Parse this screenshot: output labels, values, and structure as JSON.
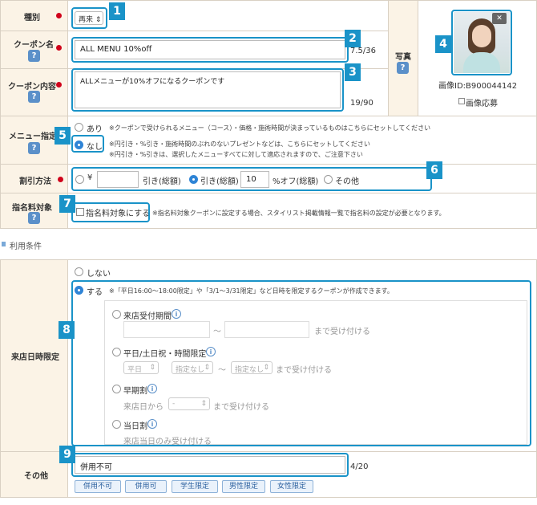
{
  "labels": {
    "type": "種別",
    "coupon_name": "クーポン名",
    "coupon_content": "クーポン内容",
    "menu": "メニュー指定",
    "discount": "割引方法",
    "nomination": "指名料対象",
    "photo": "写真",
    "visit": "来店日時限定",
    "other": "その他"
  },
  "help_icon": "?",
  "badges": [
    "1",
    "2",
    "3",
    "4",
    "5",
    "6",
    "7",
    "8",
    "9"
  ],
  "type_select": {
    "value": "再来"
  },
  "coupon_name": {
    "value": "ALL MENU 10%off",
    "count": "7.5/36"
  },
  "coupon_content": {
    "value": "ALLメニューが10%オフになるクーポンです",
    "count": "19/90"
  },
  "photo": {
    "close": "✕",
    "image_id": "画像ID:B900044142",
    "apply_label": "画像応募"
  },
  "menu": {
    "opt_yes": "あり",
    "opt_yes_note": "※クーポンで受けられるメニュー（コース）・価格・施術時間が決まっているものはこちらにセットしてください",
    "opt_no": "なし",
    "opt_no_note1": "※円引き・%引き・施術時間のぶれのないプレゼントなどは、こちらにセットしてください",
    "opt_no_note2": "※円引き・%引きは、選択したメニューすべてに対して適応されますので、ご注意下さい"
  },
  "discount": {
    "yen": "¥",
    "yen_suffix": "引き(総額)",
    "percent_label": "引き(総額)",
    "percent_value": "10",
    "percent_suffix": "%オフ(総額)",
    "other": "その他"
  },
  "nomination": {
    "checkbox_label": "指名料対象にする",
    "note": "※指名料対象クーポンに設定する場合、スタイリスト掲載情報一覧で指名料の設定が必要となります。"
  },
  "section_title": "利用条件",
  "visit": {
    "opt_none": "しない",
    "opt_do": "する",
    "opt_do_note": "※「平日16:00〜18:00限定」や「3/1〜3/31限定」など日時を限定するクーポンが作成できます。",
    "period": {
      "label": "来店受付期間",
      "sep": "〜",
      "suffix": "まで受け付ける"
    },
    "weekday": {
      "label": "平日/土日祝・時間限定",
      "day_value": "平日",
      "from_value": "指定なし",
      "sep": "〜",
      "to_value": "指定なし",
      "suffix": "まで受け付ける"
    },
    "early": {
      "label": "早期割",
      "prefix": "来店日から",
      "value": "-",
      "suffix": "まで受け付ける"
    },
    "sameday": {
      "label": "当日割",
      "text": "来店当日のみ受け付ける"
    },
    "info_icon": "i"
  },
  "other": {
    "value": "併用不可",
    "count": "4/20",
    "buttons": [
      "併用不可",
      "併用可",
      "学生限定",
      "男性限定",
      "女性限定"
    ]
  },
  "colors": {
    "accent": "#1a93c8",
    "label_bg": "#fbf3e6",
    "required": "#d0021b",
    "help": "#5b90c9"
  }
}
